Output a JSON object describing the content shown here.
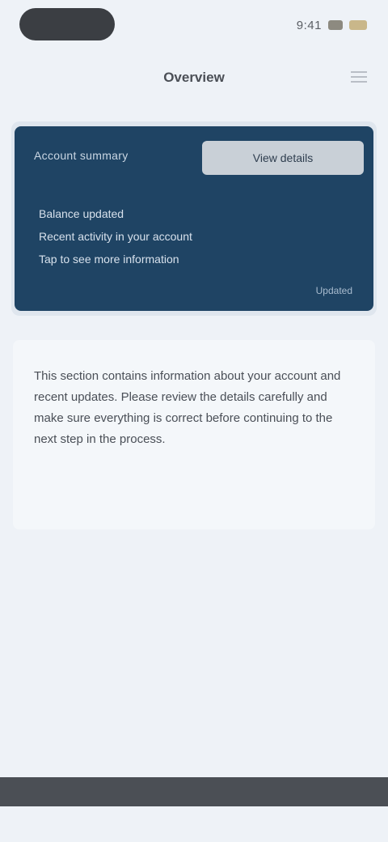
{
  "status_bar": {
    "time": "9:41"
  },
  "header": {
    "title": "Overview"
  },
  "account_card": {
    "label": "Account summary",
    "badge": "View details",
    "line1": "Balance updated",
    "line2": "Recent activity in your account",
    "line3": "Tap to see more information",
    "footer": "Updated"
  },
  "content": {
    "paragraph": "This section contains information about your account and recent updates. Please review the details carefully and make sure everything is correct before continuing to the next step in the process."
  }
}
